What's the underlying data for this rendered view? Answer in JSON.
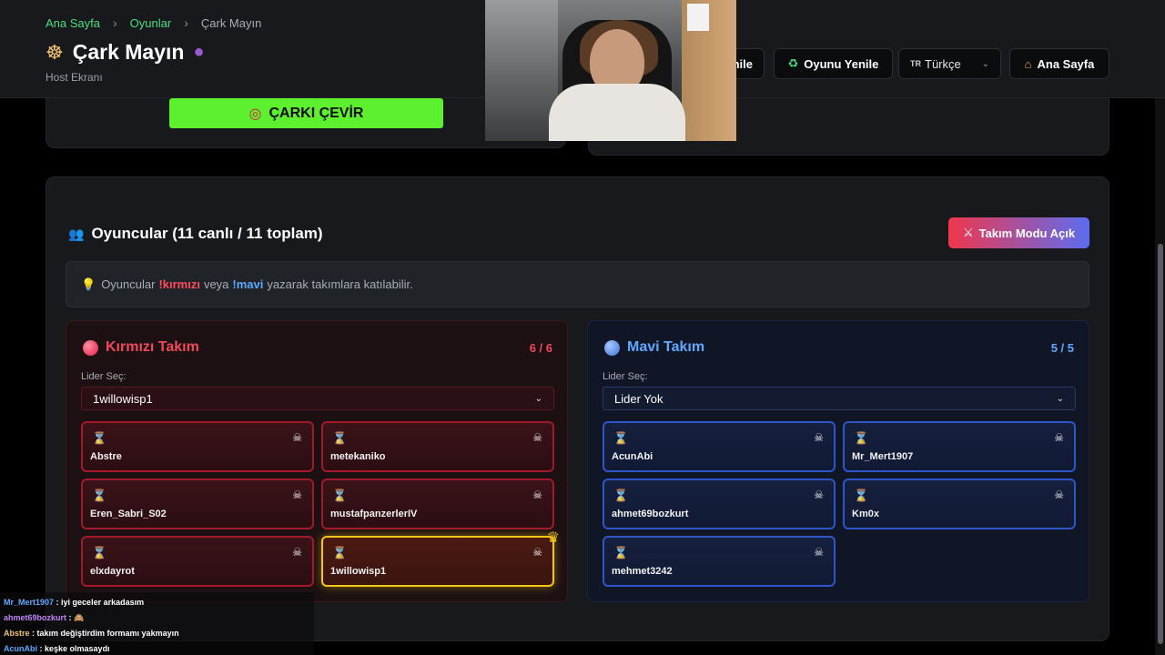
{
  "breadcrumb": {
    "home": "Ana Sayfa",
    "games": "Oyunlar",
    "current": "Çark Mayın",
    "separator": "›"
  },
  "header": {
    "title": "Çark Mayın",
    "subtitle": "Host Ekranı",
    "title_icon": "wheel-icon",
    "title_emoji": "bomb-icon"
  },
  "nav": {
    "partial_button_label": "nile",
    "refresh_game_label": "Oyunu Yenile",
    "language_flag": "TR",
    "language_label": "Türkçe",
    "home_label": "Ana Sayfa"
  },
  "spin_button_label": "ÇARKI ÇEVİR",
  "players": {
    "title": "Oyuncular (11 canlı / 11 toplam)",
    "team_mode_label": "Takım Modu Açık",
    "hint_prefix": "Oyuncular",
    "hint_red_cmd": "!kırmızı",
    "hint_middle": "veya",
    "hint_blue_cmd": "!mavi",
    "hint_suffix": "yazarak takımlara katılabilir."
  },
  "red_team": {
    "name": "Kırmızı Takım",
    "count": "6 / 6",
    "leader_label": "Lider Seç:",
    "leader_value": "1willowisp1",
    "members": [
      "Abstre",
      "metekaniko",
      "Eren_Sabri_S02",
      "mustafpanzerlerIV",
      "elxdayrot",
      "1willowisp1"
    ]
  },
  "blue_team": {
    "name": "Mavi Takım",
    "count": "5 / 5",
    "leader_label": "Lider Seç:",
    "leader_value": "Lider Yok",
    "members": [
      "AcunAbi",
      "Mr_Mert1907",
      "ahmet69bozkurt",
      "Km0x",
      "mehmet3242"
    ]
  },
  "chat": [
    {
      "user": "Mr_Mert1907",
      "message": ": iyi geceler arkadasım",
      "color": "#5ea8ff"
    },
    {
      "user": "ahmet69bozkurt",
      "message": ": 🙈",
      "color": "#c084fc"
    },
    {
      "user": "Abstre",
      "message": ": takım değiştirdim formamı yakmayın",
      "color": "#f0c070"
    },
    {
      "user": "AcunAbi",
      "message": ": keşke olmasaydı",
      "color": "#5ea8ff"
    }
  ],
  "colors": {
    "accent_green": "#4ade80",
    "spin_green": "#5cf02e",
    "red": "#f04a5a",
    "blue": "#5ea8ff",
    "leader_gold": "#f5c518"
  }
}
